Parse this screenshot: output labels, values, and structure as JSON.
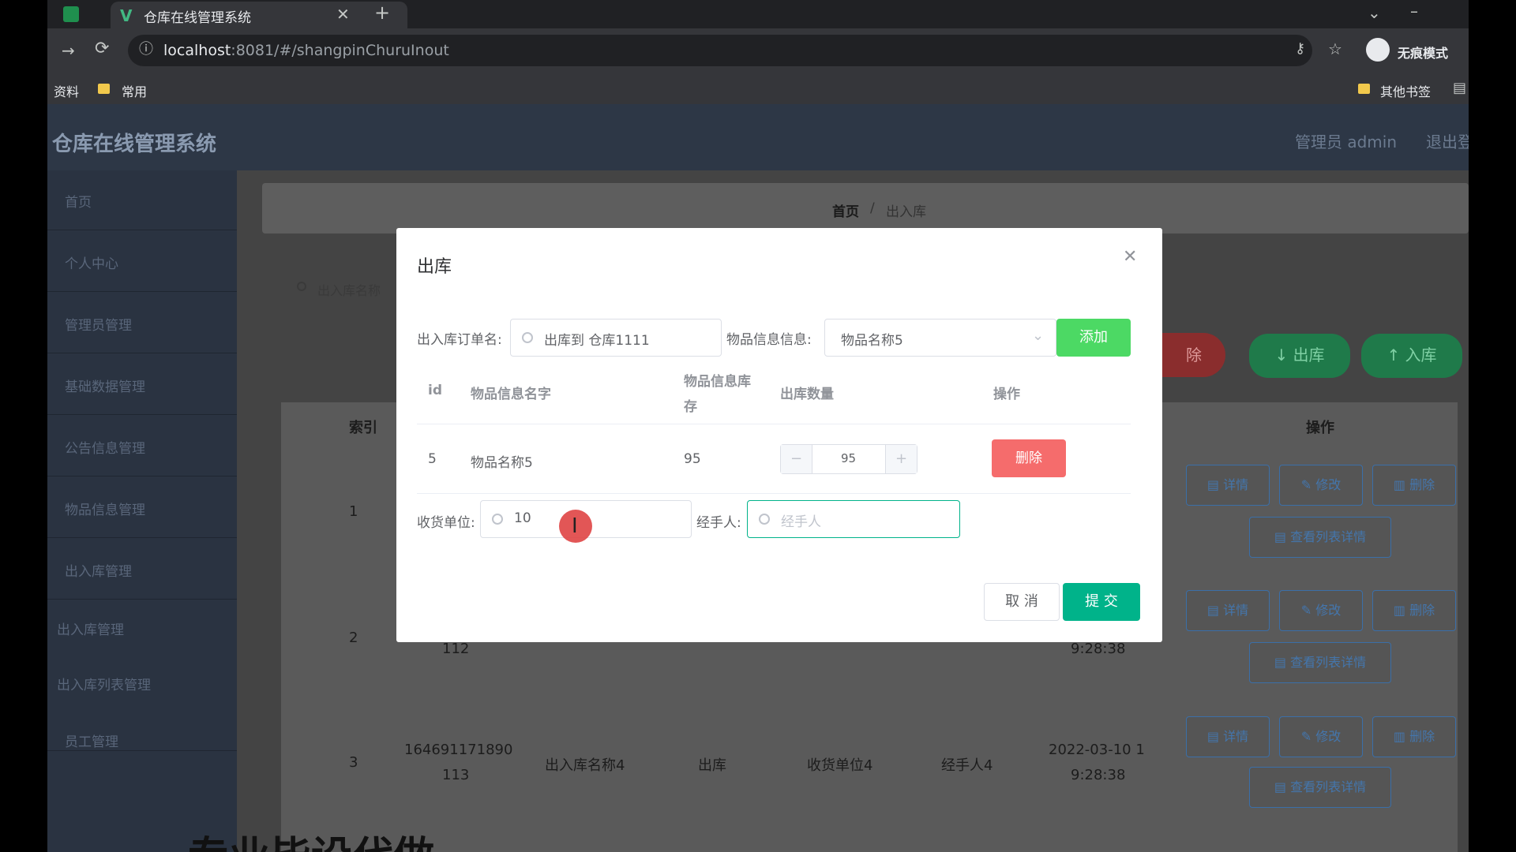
{
  "browser": {
    "tab_title": "仓库在线管理系统",
    "new_tab": "+",
    "url_host": "localhost",
    "url_rest": ":8081/#/shangpinChuruInout",
    "incognito_label": "无痕模式",
    "bookmarks": [
      "资料",
      "常用"
    ],
    "other_bookmarks": "其他书签"
  },
  "app": {
    "system_title": "仓库在线管理系统",
    "user_label": "管理员 admin",
    "logout_label": "退出登",
    "sidebar": [
      "首页",
      "个人中心",
      "管理员管理",
      "基础数据管理",
      "公告信息管理",
      "物品信息管理",
      "出入库管理",
      "出入库管理",
      "出入库列表管理",
      "员工管理"
    ],
    "breadcrumb": {
      "home": "首页",
      "sep": "/",
      "current": "出入库"
    },
    "search_placeholder": "出入库名称",
    "btn_partial_delete": "除",
    "btn_out": "↓ 出库",
    "btn_in": "↑ 入库",
    "col_index": "索引",
    "col_action": "操作",
    "row_actions": {
      "detail": "详情",
      "edit": "修改",
      "delete": "删除",
      "list_detail": "查看列表详情"
    },
    "rows": [
      {
        "index": "1"
      },
      {
        "index": "2",
        "code_tail": "112",
        "time_tail": "9:28:38"
      },
      {
        "index": "3",
        "code_line1": "164691171890",
        "code_line2": "113",
        "name": "出入库名称4",
        "type": "出库",
        "unit": "收货单位4",
        "handler": "经手人4",
        "time_line1": "2022-03-10 1",
        "time_line2": "9:28:38"
      }
    ]
  },
  "modal": {
    "title": "出库",
    "order_name_label": "出入库订单名:",
    "order_name_value": "出库到 仓库1111",
    "goods_info_label": "物品信息信息:",
    "goods_info_value": "物品名称5",
    "add_button": "添加",
    "table_headers": {
      "id": "id",
      "name": "物品信息名字",
      "stock_line1": "物品信息库",
      "stock_line2": "存",
      "qty": "出库数量",
      "action": "操作"
    },
    "table_rows": [
      {
        "id": "5",
        "name": "物品名称5",
        "stock": "95",
        "qty": "95",
        "delete": "删除"
      }
    ],
    "receiver_label": "收货单位:",
    "receiver_value": "10",
    "handler_label": "经手人:",
    "handler_placeholder": "经手人",
    "cancel_button": "取 消",
    "submit_button": "提 交"
  },
  "overlay_text": "专业毕设代做",
  "colors": {
    "primary_green": "#00b38a",
    "add_green": "#4cd964",
    "danger": "#f56c6c",
    "sidebar": "#2a3341"
  }
}
